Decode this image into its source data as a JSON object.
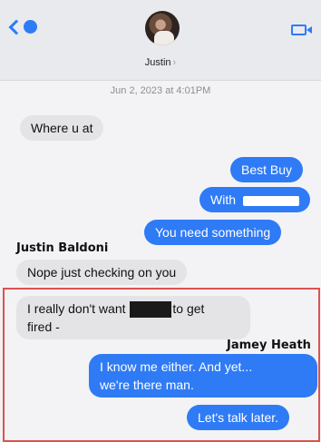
{
  "header": {
    "back_badge": "",
    "contact_name": "Justin",
    "chevron": "›"
  },
  "thread": {
    "timestamp": "Jun 2, 2023 at 4:01PM",
    "messages": [
      {
        "text": "Where u at"
      },
      {
        "text": "Best Buy"
      },
      {
        "text": "With"
      },
      {
        "text": "You need something"
      },
      {
        "text": "Nope just checking on you"
      },
      {
        "text_before": "I really don't want",
        "text_after": "to get",
        "line2": "fired -"
      },
      {
        "line1": "I know me either.  And yet...",
        "line2": "we're there man."
      },
      {
        "text": "Let's talk later."
      }
    ],
    "senders": {
      "justin": "Justin Baldoni",
      "jamey": "Jamey Heath"
    }
  },
  "colors": {
    "outgoing": "#2f7bf6",
    "incoming": "#e4e4e7",
    "highlight": "#d9534f"
  }
}
